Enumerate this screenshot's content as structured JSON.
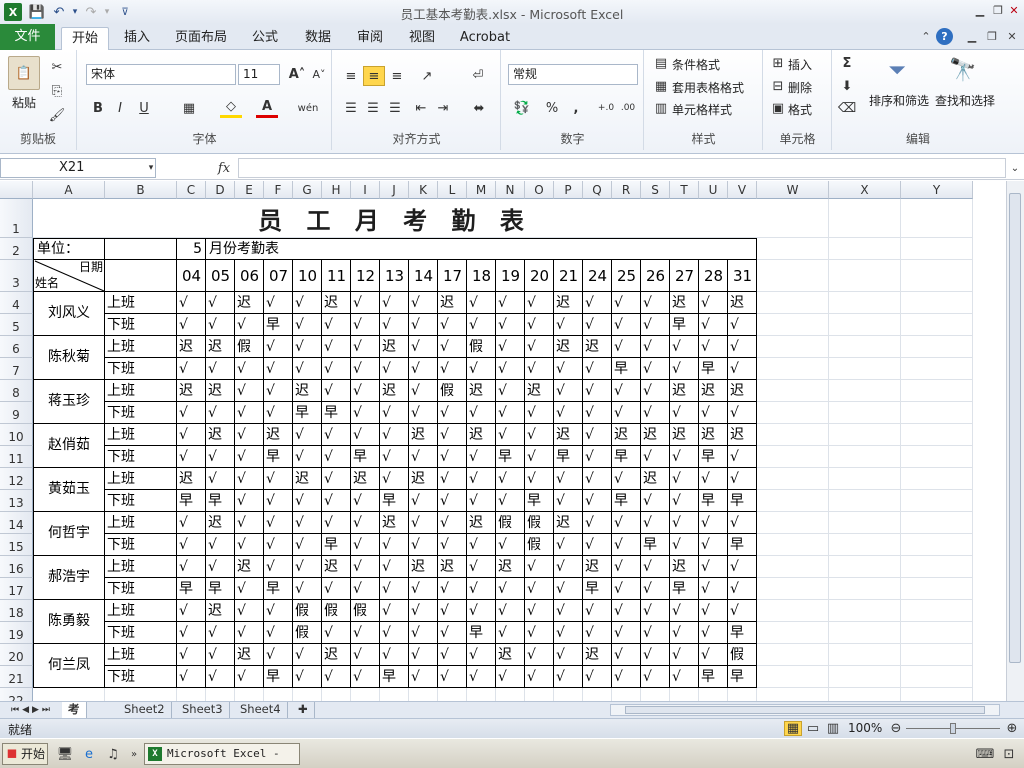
{
  "window": {
    "title": "员工基本考勤表.xlsx - Microsoft Excel"
  },
  "tabs": {
    "file": "文件",
    "home": "开始",
    "insert": "插入",
    "layout": "页面布局",
    "formulas": "公式",
    "data": "数据",
    "review": "审阅",
    "view": "视图",
    "acrobat": "Acrobat"
  },
  "ribbon": {
    "clipboard": {
      "label": "剪贴板",
      "paste": "粘贴"
    },
    "font": {
      "label": "字体",
      "name": "宋体",
      "size": "11"
    },
    "alignment": {
      "label": "对齐方式"
    },
    "number": {
      "label": "数字",
      "format": "常规"
    },
    "styles": {
      "label": "样式",
      "conditional": "条件格式",
      "table": "套用表格格式",
      "cell": "单元格样式"
    },
    "cells": {
      "label": "单元格",
      "insert": "插入",
      "delete": "删除",
      "format": "格式"
    },
    "editing": {
      "label": "编辑",
      "sort": "排序和筛选",
      "find": "查找和选择"
    }
  },
  "formula_bar": {
    "name_box": "X21",
    "fx": "fx",
    "value": ""
  },
  "columns": [
    "A",
    "B",
    "C",
    "D",
    "E",
    "F",
    "G",
    "H",
    "I",
    "J",
    "K",
    "L",
    "M",
    "N",
    "O",
    "P",
    "Q",
    "R",
    "S",
    "T",
    "U",
    "V",
    "W",
    "X",
    "Y"
  ],
  "rows": [
    "1",
    "2",
    "3",
    "4",
    "5",
    "6",
    "7",
    "8",
    "9",
    "10",
    "11",
    "12",
    "13",
    "14",
    "15",
    "16",
    "17",
    "18",
    "19",
    "20",
    "21",
    "22"
  ],
  "sheet": {
    "title": "员 工 月 考 勤 表",
    "unit_label": "单位：",
    "month": "5",
    "month_suffix": "月份考勤表",
    "header_date": "日期",
    "header_name": "姓名",
    "dates": [
      "04",
      "05",
      "06",
      "07",
      "10",
      "11",
      "12",
      "13",
      "14",
      "17",
      "18",
      "19",
      "20",
      "21",
      "24",
      "25",
      "26",
      "27",
      "28",
      "31"
    ],
    "employees": [
      {
        "name": "刘风义",
        "on": [
          "√",
          "√",
          "迟",
          "√",
          "√",
          "迟",
          "√",
          "√",
          "√",
          "迟",
          "√",
          "√",
          "√",
          "迟",
          "√",
          "√",
          "√",
          "迟",
          "√",
          "迟"
        ],
        "off": [
          "√",
          "√",
          "√",
          "早",
          "√",
          "√",
          "√",
          "√",
          "√",
          "√",
          "√",
          "√",
          "√",
          "√",
          "√",
          "√",
          "√",
          "早",
          "√",
          "√"
        ]
      },
      {
        "name": "陈秋菊",
        "on": [
          "迟",
          "迟",
          "假",
          "√",
          "√",
          "√",
          "√",
          "迟",
          "√",
          "√",
          "假",
          "√",
          "√",
          "迟",
          "迟",
          "√",
          "√",
          "√",
          "√",
          "√"
        ],
        "off": [
          "√",
          "√",
          "√",
          "√",
          "√",
          "√",
          "√",
          "√",
          "√",
          "√",
          "√",
          "√",
          "√",
          "√",
          "√",
          "早",
          "√",
          "√",
          "早",
          "√"
        ]
      },
      {
        "name": "蒋玉珍",
        "on": [
          "迟",
          "迟",
          "√",
          "√",
          "迟",
          "√",
          "√",
          "迟",
          "√",
          "假",
          "迟",
          "√",
          "迟",
          "√",
          "√",
          "√",
          "√",
          "迟",
          "迟",
          "迟"
        ],
        "off": [
          "√",
          "√",
          "√",
          "√",
          "早",
          "早",
          "√",
          "√",
          "√",
          "√",
          "√",
          "√",
          "√",
          "√",
          "√",
          "√",
          "√",
          "√",
          "√",
          "√"
        ]
      },
      {
        "name": "赵俏茹",
        "on": [
          "√",
          "迟",
          "√",
          "迟",
          "√",
          "√",
          "√",
          "√",
          "迟",
          "√",
          "迟",
          "√",
          "√",
          "迟",
          "√",
          "迟",
          "迟",
          "迟",
          "迟",
          "迟"
        ],
        "off": [
          "√",
          "√",
          "√",
          "早",
          "√",
          "√",
          "早",
          "√",
          "√",
          "√",
          "√",
          "早",
          "√",
          "早",
          "√",
          "早",
          "√",
          "√",
          "早",
          "√"
        ]
      },
      {
        "name": "黄茹玉",
        "on": [
          "迟",
          "√",
          "√",
          "√",
          "迟",
          "√",
          "迟",
          "√",
          "迟",
          "√",
          "√",
          "√",
          "√",
          "√",
          "√",
          "√",
          "迟",
          "√",
          "√",
          "√"
        ],
        "off": [
          "早",
          "早",
          "√",
          "√",
          "√",
          "√",
          "√",
          "早",
          "√",
          "√",
          "√",
          "√",
          "早",
          "√",
          "√",
          "早",
          "√",
          "√",
          "早",
          "早"
        ]
      },
      {
        "name": "何哲宇",
        "on": [
          "√",
          "迟",
          "√",
          "√",
          "√",
          "√",
          "√",
          "迟",
          "√",
          "√",
          "迟",
          "假",
          "假",
          "迟",
          "√",
          "√",
          "√",
          "√",
          "√",
          "√"
        ],
        "off": [
          "√",
          "√",
          "√",
          "√",
          "√",
          "早",
          "√",
          "√",
          "√",
          "√",
          "√",
          "√",
          "假",
          "√",
          "√",
          "√",
          "早",
          "√",
          "√",
          "早"
        ]
      },
      {
        "name": "郝浩宇",
        "on": [
          "√",
          "√",
          "迟",
          "√",
          "√",
          "迟",
          "√",
          "√",
          "迟",
          "迟",
          "√",
          "迟",
          "√",
          "√",
          "迟",
          "√",
          "√",
          "迟",
          "√",
          "√"
        ],
        "off": [
          "早",
          "早",
          "√",
          "早",
          "√",
          "√",
          "√",
          "√",
          "√",
          "√",
          "√",
          "√",
          "√",
          "√",
          "早",
          "√",
          "√",
          "早",
          "√",
          "√"
        ]
      },
      {
        "name": "陈勇毅",
        "on": [
          "√",
          "迟",
          "√",
          "√",
          "假",
          "假",
          "假",
          "√",
          "√",
          "√",
          "√",
          "√",
          "√",
          "√",
          "√",
          "√",
          "√",
          "√",
          "√",
          "√"
        ],
        "off": [
          "√",
          "√",
          "√",
          "√",
          "假",
          "√",
          "√",
          "√",
          "√",
          "√",
          "早",
          "√",
          "√",
          "√",
          "√",
          "√",
          "√",
          "√",
          "√",
          "早"
        ]
      },
      {
        "name": "何兰凤",
        "on": [
          "√",
          "√",
          "迟",
          "√",
          "√",
          "迟",
          "√",
          "√",
          "√",
          "√",
          "√",
          "迟",
          "√",
          "√",
          "迟",
          "√",
          "√",
          "√",
          "√",
          "假"
        ],
        "off": [
          "√",
          "√",
          "√",
          "早",
          "√",
          "√",
          "√",
          "早",
          "√",
          "√",
          "√",
          "√",
          "√",
          "√",
          "√",
          "√",
          "√",
          "√",
          "早",
          "早"
        ]
      }
    ],
    "shift_on": "上班",
    "shift_off": "下班"
  },
  "sheet_tabs": [
    "考勤表",
    "Sheet2",
    "Sheet3",
    "Sheet4"
  ],
  "status": {
    "ready": "就绪",
    "zoom": "100%"
  },
  "taskbar": {
    "start": "开始",
    "task": "Microsoft Excel - ..."
  }
}
